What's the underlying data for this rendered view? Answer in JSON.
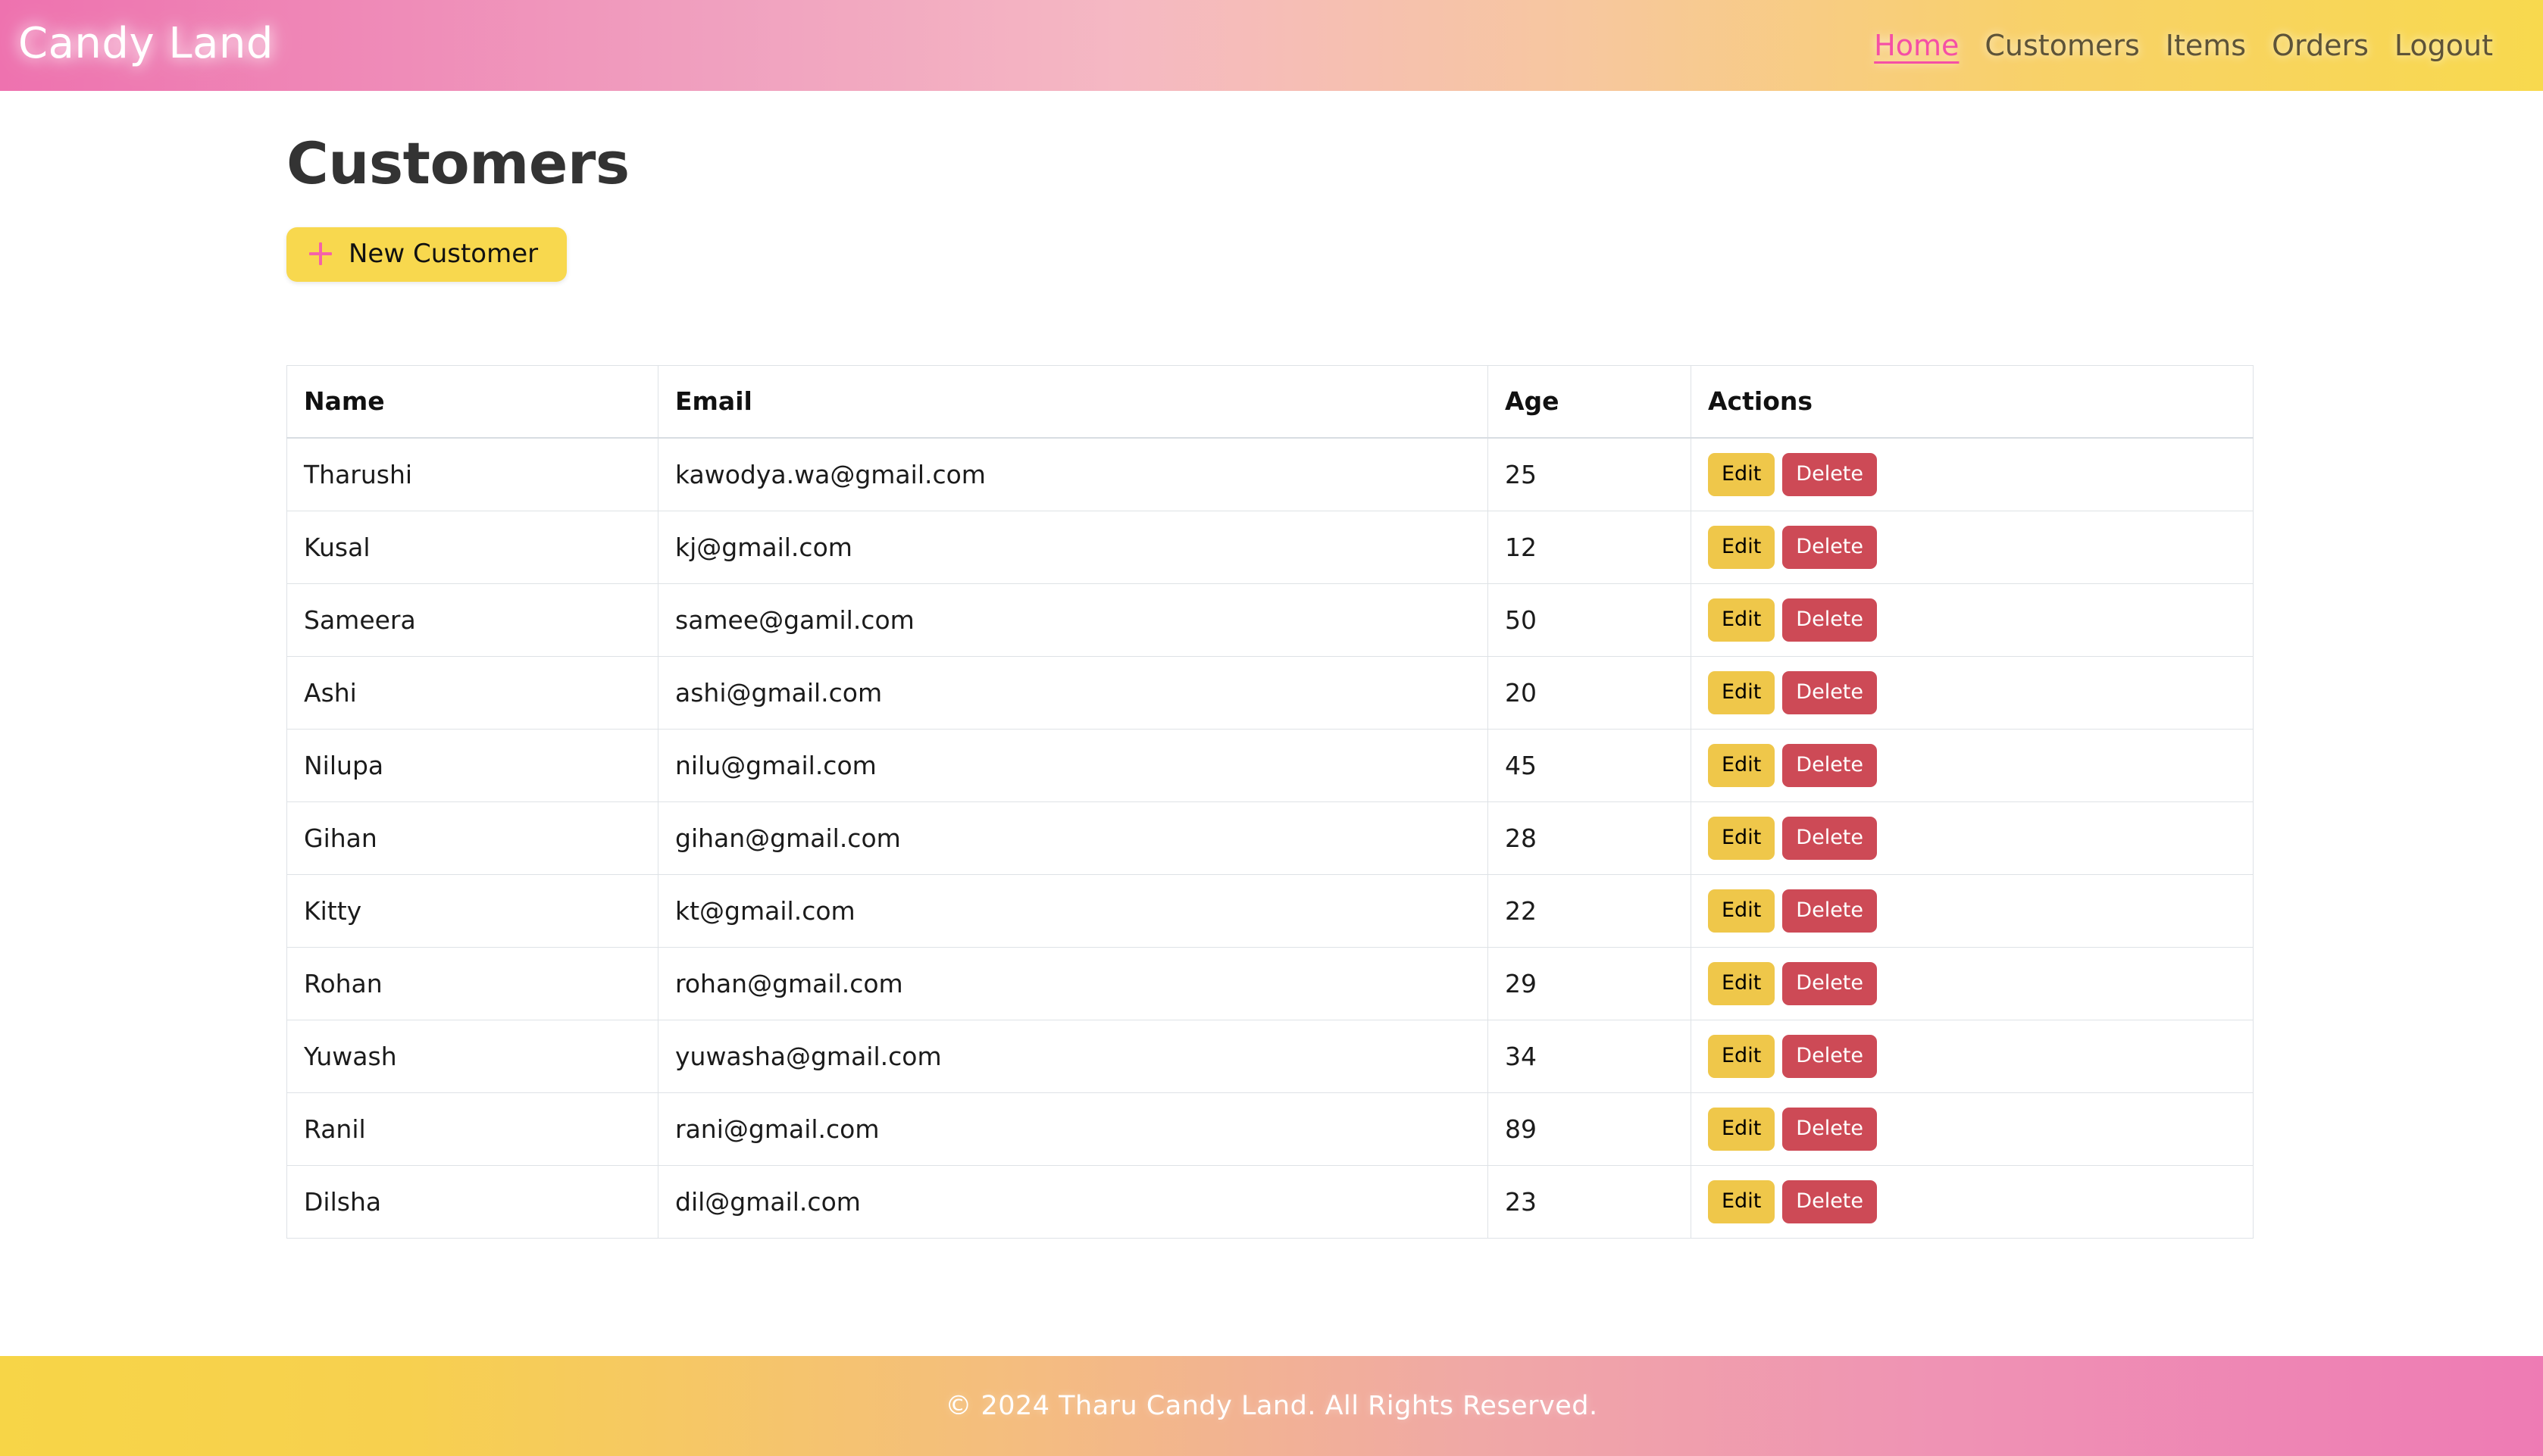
{
  "header": {
    "brand": "Candy Land",
    "nav": [
      {
        "label": "Home",
        "active": true
      },
      {
        "label": "Customers",
        "active": false
      },
      {
        "label": "Items",
        "active": false
      },
      {
        "label": "Orders",
        "active": false
      },
      {
        "label": "Logout",
        "active": false
      }
    ]
  },
  "main": {
    "page_title": "Customers",
    "new_customer_button": "New Customer",
    "plus_icon": "plus-icon"
  },
  "table": {
    "columns": [
      "Name",
      "Email",
      "Age",
      "Actions"
    ],
    "edit_label": "Edit",
    "delete_label": "Delete",
    "rows": [
      {
        "name": "Tharushi",
        "email": "kawodya.wa@gmail.com",
        "age": "25"
      },
      {
        "name": "Kusal",
        "email": "kj@gmail.com",
        "age": "12"
      },
      {
        "name": "Sameera",
        "email": "samee@gamil.com",
        "age": "50"
      },
      {
        "name": "Ashi",
        "email": "ashi@gmail.com",
        "age": "20"
      },
      {
        "name": "Nilupa",
        "email": "nilu@gmail.com",
        "age": "45"
      },
      {
        "name": "Gihan",
        "email": "gihan@gmail.com",
        "age": "28"
      },
      {
        "name": "Kitty",
        "email": "kt@gmail.com",
        "age": "22"
      },
      {
        "name": "Rohan",
        "email": "rohan@gmail.com",
        "age": "29"
      },
      {
        "name": "Yuwash",
        "email": "yuwasha@gmail.com",
        "age": "34"
      },
      {
        "name": "Ranil",
        "email": "rani@gmail.com",
        "age": "89"
      },
      {
        "name": "Dilsha",
        "email": "dil@gmail.com",
        "age": "23"
      }
    ]
  },
  "footer": {
    "copyright": "© 2024 Tharu Candy Land. All Rights Reserved."
  },
  "colors": {
    "brand_pink": "#ee7bb4",
    "brand_yellow": "#f7d547",
    "active_link_pink": "#f54fa5",
    "nav_text": "#5d5338",
    "edit_yellow": "#efc74a",
    "delete_red": "#cd4a56",
    "table_border": "#dee2e6",
    "title_dark": "#333333"
  }
}
